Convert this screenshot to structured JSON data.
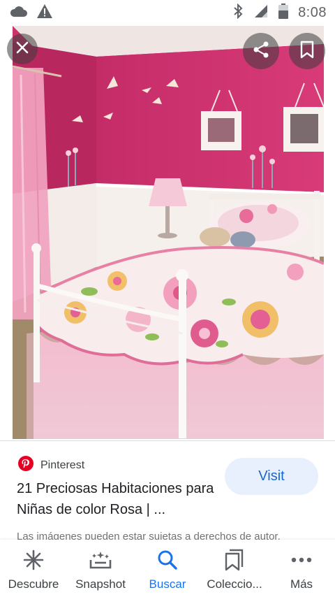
{
  "status_bar": {
    "time": "8:08",
    "icons": [
      "cloud-icon",
      "warning-icon",
      "bluetooth-icon",
      "signal-icon",
      "battery-icon"
    ]
  },
  "image_viewer": {
    "image_subject": "pink girls bedroom",
    "close_icon": "close-icon",
    "share_icon": "share-icon",
    "save_icon": "bookmark-icon"
  },
  "result": {
    "source_name": "Pinterest",
    "source_icon": "pinterest-logo",
    "title": "21 Preciosas Habitaciones para Niñas de color Rosa | ...",
    "visit_label": "Visit",
    "disclaimer": "Las imágenes pueden estar sujetas a derechos de autor."
  },
  "bottom_nav": {
    "items": [
      {
        "label": "Descubre",
        "icon": "asterisk-icon",
        "active": false
      },
      {
        "label": "Snapshot",
        "icon": "snapshot-icon",
        "active": false
      },
      {
        "label": "Buscar",
        "icon": "search-icon",
        "active": true
      },
      {
        "label": "Coleccio...",
        "icon": "collections-icon",
        "active": false
      },
      {
        "label": "Más",
        "icon": "more-icon",
        "active": false
      }
    ]
  },
  "colors": {
    "accent": "#1a73e8",
    "visit_bg": "#e8f0fe",
    "pinterest_red": "#e60023",
    "wall_pink": "#d2356f"
  }
}
